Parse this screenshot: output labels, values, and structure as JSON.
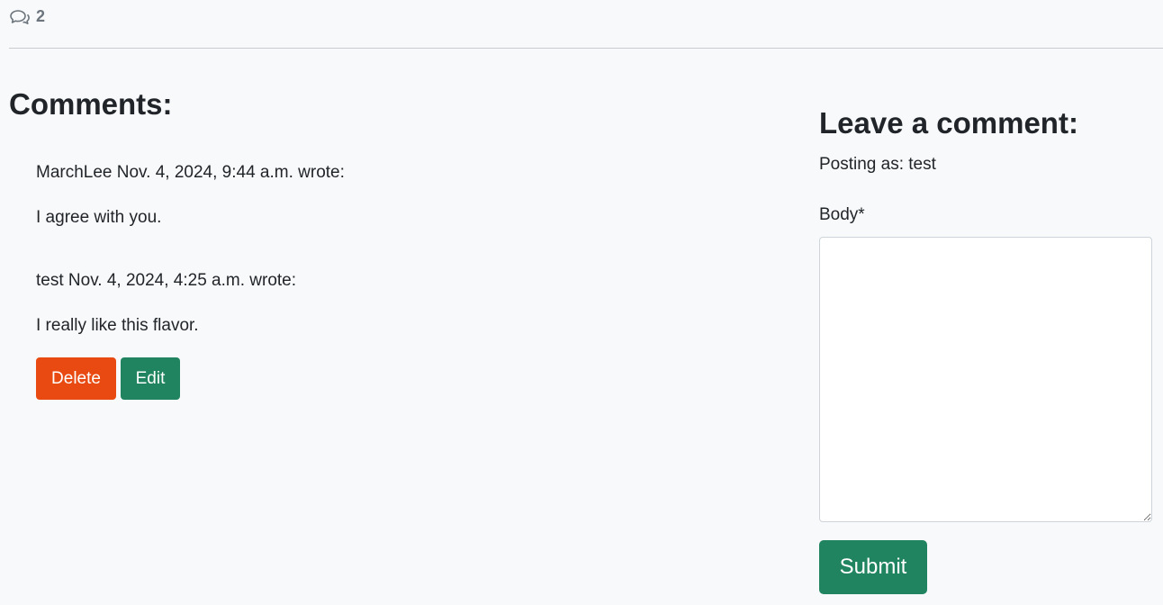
{
  "header": {
    "comment_icon": "comments-icon",
    "comment_count": "2"
  },
  "comments_section": {
    "heading": "Comments:",
    "comments": [
      {
        "meta": "MarchLee Nov. 4, 2024, 9:44 a.m. wrote:",
        "body": "I agree with you."
      },
      {
        "meta": "test Nov. 4, 2024, 4:25 a.m. wrote:",
        "body": "I really like this flavor.",
        "actions": {
          "delete_label": "Delete",
          "edit_label": "Edit"
        }
      }
    ]
  },
  "comment_form": {
    "heading": "Leave a comment:",
    "posting_as": "Posting as: test",
    "body_label": "Body*",
    "body_value": "",
    "submit_label": "Submit"
  },
  "colors": {
    "delete": "#e84a12",
    "edit": "#1f845f",
    "submit": "#1f845f",
    "background": "#f8f9fa"
  }
}
